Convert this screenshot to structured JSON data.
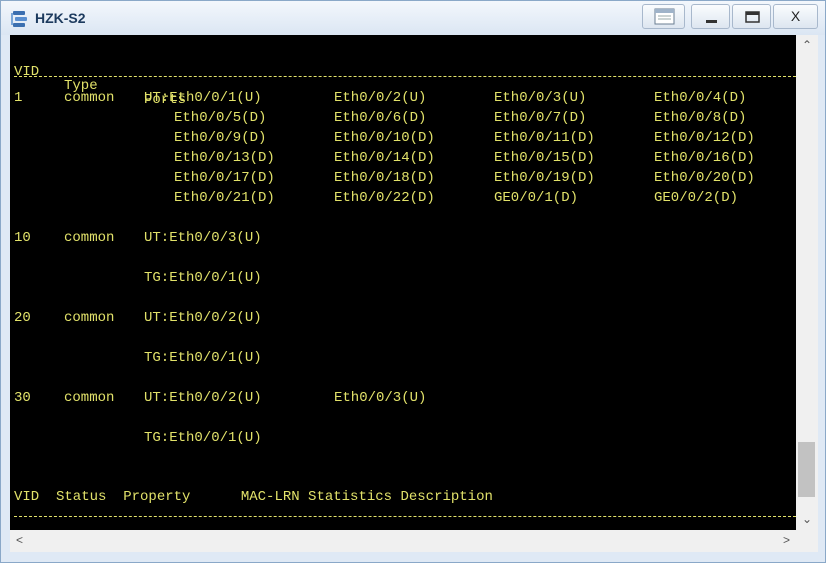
{
  "window": {
    "title": "HZK-S2",
    "close_label": "X"
  },
  "vlan_header": {
    "vid": "VID",
    "type": "Type",
    "ports": "Ports"
  },
  "vlan_rows": [
    {
      "vid": "1",
      "type": "common",
      "lines": [
        [
          "UT:Eth0/0/1(U)",
          "Eth0/0/2(U)",
          "Eth0/0/3(U)",
          "Eth0/0/4(D)"
        ],
        [
          "Eth0/0/5(D)",
          "Eth0/0/6(D)",
          "Eth0/0/7(D)",
          "Eth0/0/8(D)"
        ],
        [
          "Eth0/0/9(D)",
          "Eth0/0/10(D)",
          "Eth0/0/11(D)",
          "Eth0/0/12(D)"
        ],
        [
          "Eth0/0/13(D)",
          "Eth0/0/14(D)",
          "Eth0/0/15(D)",
          "Eth0/0/16(D)"
        ],
        [
          "Eth0/0/17(D)",
          "Eth0/0/18(D)",
          "Eth0/0/19(D)",
          "Eth0/0/20(D)"
        ],
        [
          "Eth0/0/21(D)",
          "Eth0/0/22(D)",
          "GE0/0/1(D)",
          "GE0/0/2(D)"
        ]
      ]
    },
    {
      "vid": "10",
      "type": "common",
      "ut": "UT:Eth0/0/3(U)",
      "tg": "TG:Eth0/0/1(U)"
    },
    {
      "vid": "20",
      "type": "common",
      "ut": "UT:Eth0/0/2(U)",
      "tg": "TG:Eth0/0/1(U)"
    },
    {
      "vid": "30",
      "type": "common",
      "ut": "UT:Eth0/0/2(U)",
      "ut2": "Eth0/0/3(U)",
      "tg": "TG:Eth0/0/1(U)"
    }
  ],
  "status_header": "VID  Status  Property      MAC-LRN Statistics Description",
  "colors": {
    "terminal_bg": "#000000",
    "terminal_text": "#e2e26a"
  },
  "icons": [
    "switch-icon",
    "system-menu-icon",
    "minimize-icon",
    "maximize-icon",
    "close-icon",
    "scroll-up-icon",
    "scroll-down-icon",
    "scroll-left-icon",
    "scroll-right-icon"
  ]
}
